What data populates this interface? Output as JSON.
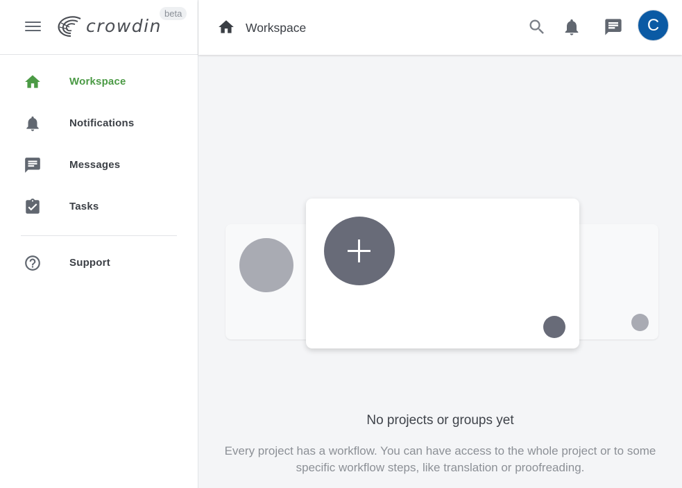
{
  "brand": {
    "name": "crowdin",
    "badge": "beta"
  },
  "sidebar": {
    "items": [
      {
        "label": "Workspace",
        "icon": "home-icon",
        "active": true
      },
      {
        "label": "Notifications",
        "icon": "bell-icon",
        "active": false
      },
      {
        "label": "Messages",
        "icon": "message-icon",
        "active": false
      },
      {
        "label": "Tasks",
        "icon": "clipboard-check-icon",
        "active": false
      },
      {
        "label": "Support",
        "icon": "help-circle-icon",
        "active": false
      }
    ]
  },
  "header": {
    "breadcrumb_icon": "home-icon",
    "title": "Workspace",
    "actions": [
      "search-icon",
      "bell-icon",
      "message-icon"
    ],
    "avatar_initial": "C"
  },
  "empty_state": {
    "title": "No projects or groups yet",
    "description": "Every project has a workflow. You can have access to the whole project or to some specific workflow steps, like translation or proofreading."
  },
  "colors": {
    "accent_green": "#4b9a45",
    "avatar_blue": "#0b5aa4",
    "icon_gray": "#616770",
    "placeholder_dark": "#686b78",
    "placeholder_light": "#a9abb3",
    "main_bg": "#f4f5f7"
  }
}
